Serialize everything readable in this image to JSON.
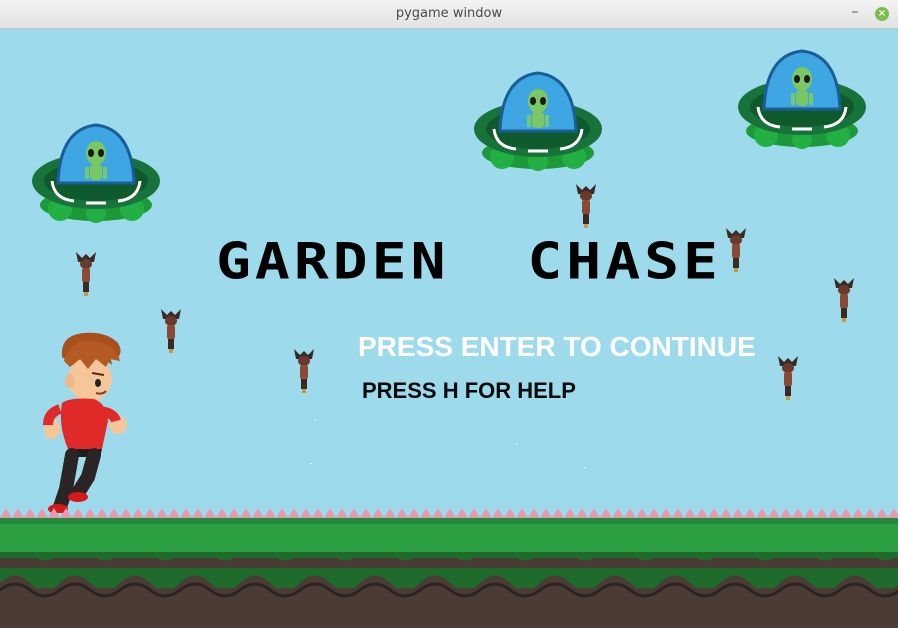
{
  "window": {
    "title": "pygame window",
    "minimize_glyph": "–",
    "close_glyph": "×"
  },
  "game": {
    "title": "GARDEN  CHASE",
    "continue_prompt": "PRESS ENTER TO CONTINUE",
    "help_prompt": "PRESS H FOR HELP"
  },
  "colors": {
    "sky": "#9ddbec",
    "ufo_body": "#1f7a3f",
    "ufo_dome": "#3aa3e0",
    "alien": "#7dc95e",
    "grass": "#2e8b3a",
    "soil": "#4a3b35",
    "player_shirt": "#e02a2a"
  },
  "icons": {
    "ufos": [
      "ufo-alien-icon",
      "ufo-alien-icon",
      "ufo-alien-icon"
    ],
    "bombs": [
      "bomb-icon",
      "bomb-icon",
      "bomb-icon",
      "bomb-icon",
      "bomb-icon",
      "bomb-icon",
      "bomb-icon",
      "bomb-icon"
    ],
    "player": "running-boy-icon"
  }
}
